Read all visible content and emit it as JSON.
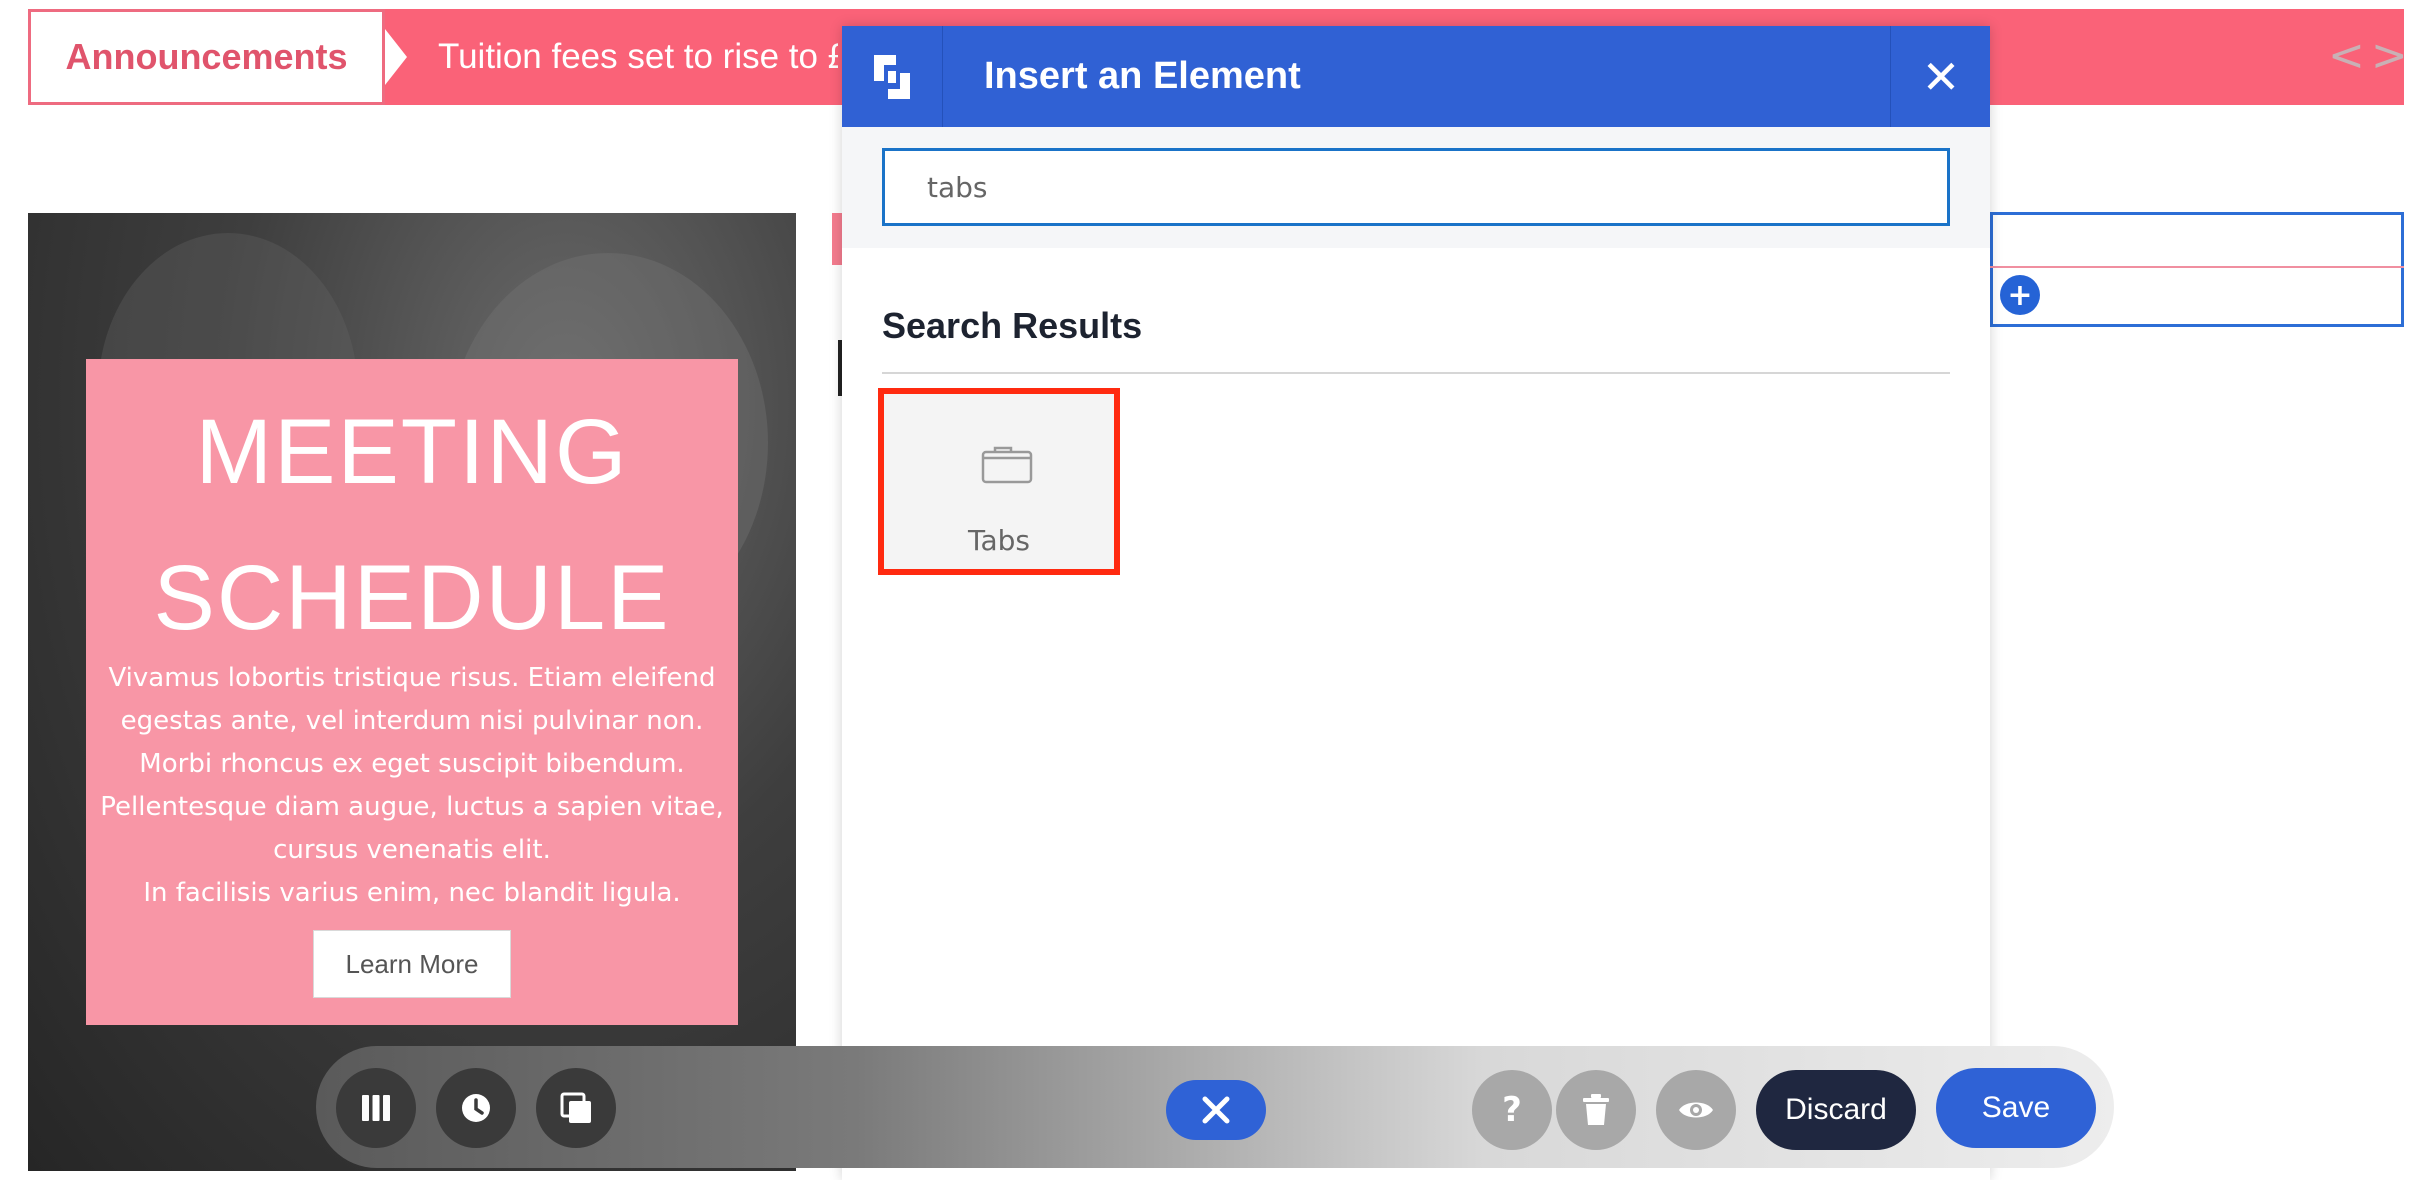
{
  "announcement": {
    "label": "Announcements",
    "text": "Tuition fees set to rise to £",
    "nav": "<>"
  },
  "hero": {
    "title": "MEETING SCHEDULE",
    "body": [
      "Vivamus lobortis tristique risus. Etiam eleifend",
      "egestas ante, vel interdum nisi pulvinar non.",
      "Morbi rhoncus ex eget suscipit bibendum.",
      "Pellentesque diam augue, luctus a sapien vitae,",
      "cursus venenatis elit.",
      "In facilisis varius enim, nec blandit ligula."
    ],
    "button_label": "Learn More"
  },
  "modal": {
    "title": "Insert an Element",
    "search_value": "tabs",
    "results_heading": "Search Results",
    "results": [
      {
        "label": "Tabs",
        "icon": "tabs-icon"
      }
    ]
  },
  "toolbar": {
    "buttons": [
      "columns-icon",
      "history-icon",
      "layers-icon",
      "close-icon",
      "help-icon",
      "trash-icon",
      "eye-icon"
    ],
    "discard_label": "Discard",
    "save_label": "Save"
  },
  "colors": {
    "announcement_bar": "#fa6278",
    "modal_header": "#3061d4",
    "card": "#f896a6",
    "highlight": "#ff2a10",
    "primary_button": "#2f62d6",
    "discard_button": "#1f2740"
  }
}
